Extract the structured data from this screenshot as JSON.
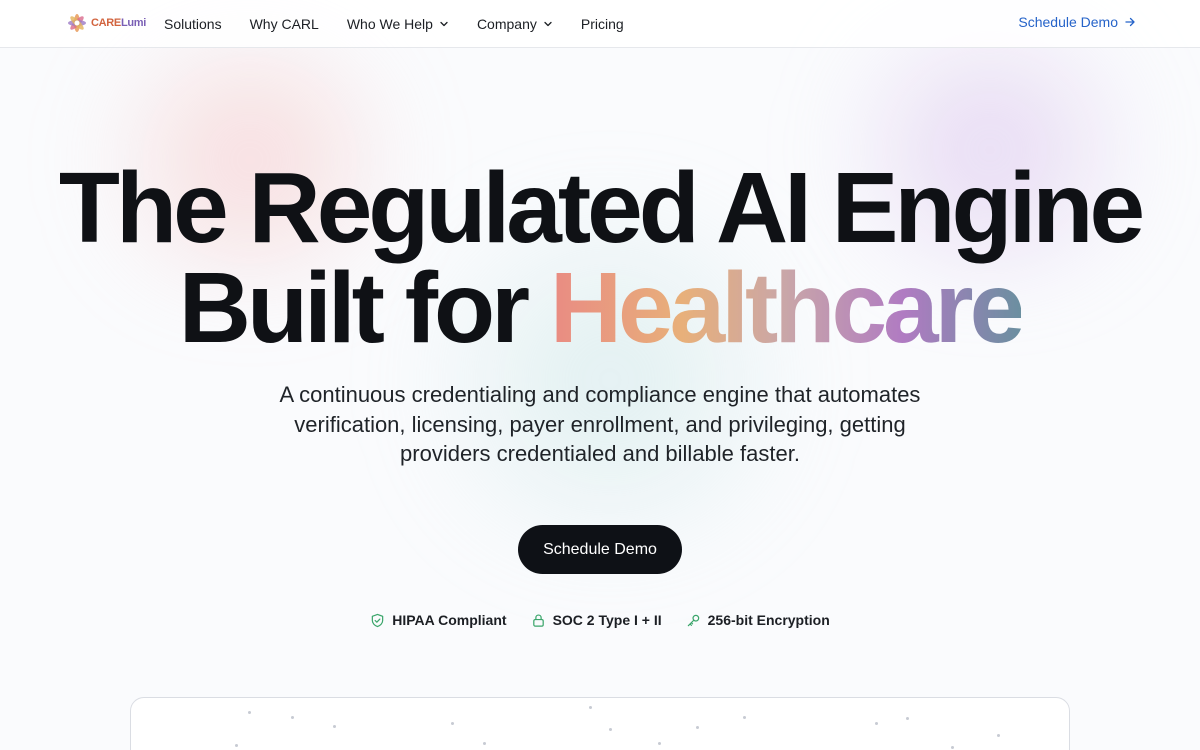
{
  "brand": {
    "logo_care": "CARE",
    "logo_lumi": "Lumi",
    "colors": {
      "care": "#d2643f",
      "lumi": "#7a5fb5",
      "accent_blue": "#2563c9",
      "cta_dark": "#0e1116",
      "badge_green": "#3aa56a"
    }
  },
  "nav": {
    "items": [
      {
        "label": "Solutions",
        "has_dropdown": false
      },
      {
        "label": "Why CARL",
        "has_dropdown": false
      },
      {
        "label": "Who We Help",
        "has_dropdown": true
      },
      {
        "label": "Company",
        "has_dropdown": true
      },
      {
        "label": "Pricing",
        "has_dropdown": false
      }
    ],
    "cta_label": "Schedule Demo",
    "cta_icon": "arrow-right-icon"
  },
  "hero": {
    "title_line1": "The Regulated AI Engine",
    "title_line2_prefix": "Built for ",
    "title_line2_highlight": "Healthcare",
    "subtitle": "A continuous credentialing and compliance engine that automates verification, licensing, payer enrollment, and privileging, getting providers credentialed and billable faster.",
    "cta_label": "Schedule Demo"
  },
  "badges": [
    {
      "label": "HIPAA Compliant",
      "icon": "shield-check-icon"
    },
    {
      "label": "SOC 2 Type I + II",
      "icon": "lock-icon"
    },
    {
      "label": "256-bit Encryption",
      "icon": "key-icon"
    }
  ]
}
